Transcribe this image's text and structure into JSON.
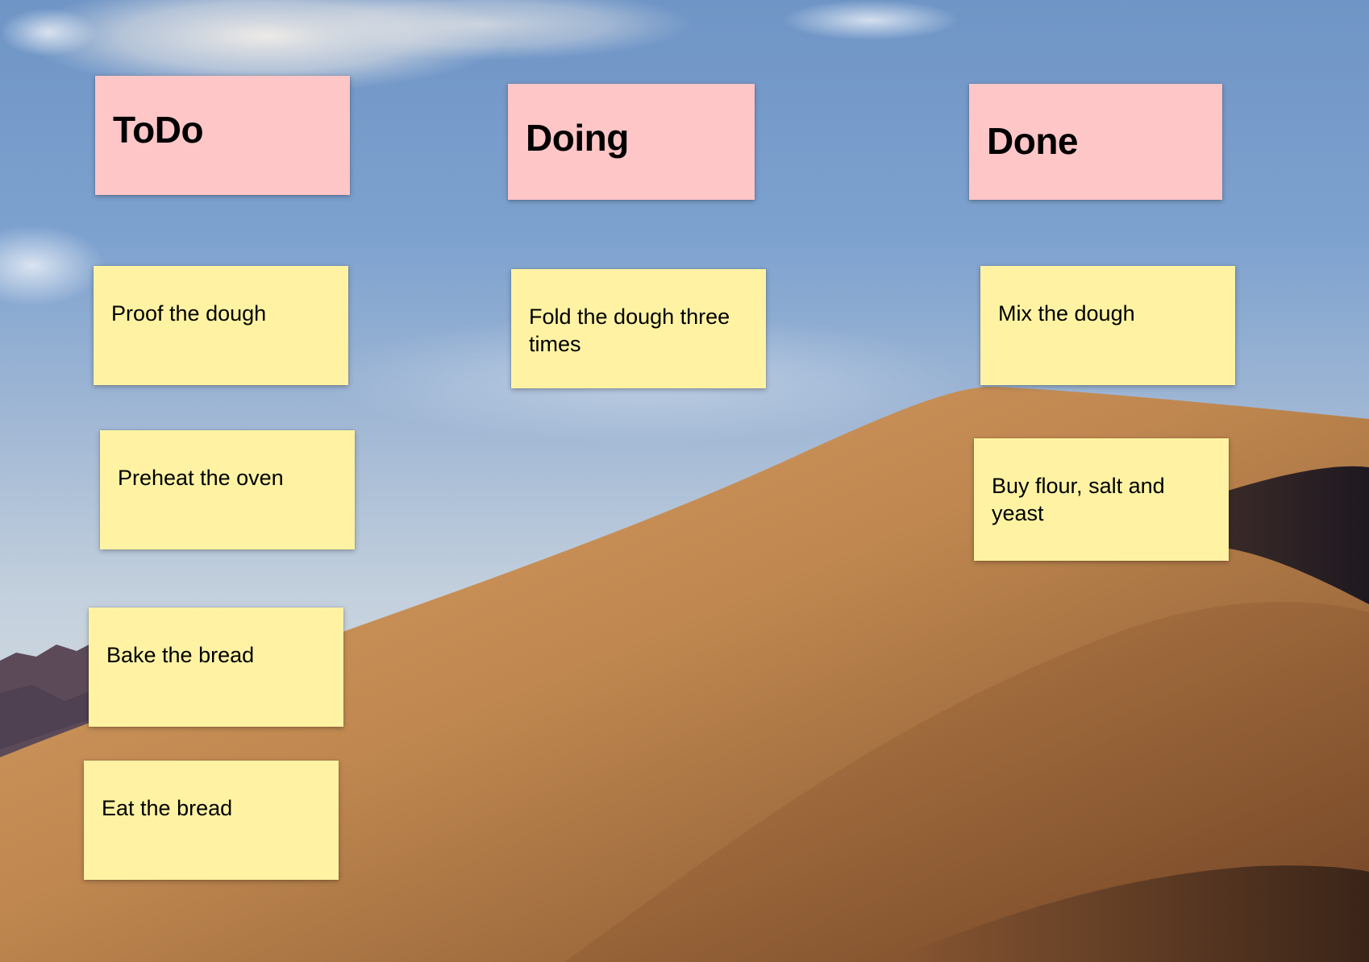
{
  "board": {
    "background": {
      "description": "macOS Mojave desert dune wallpaper",
      "sky_color": "#7ea2cf",
      "dune_color": "#c98f56"
    },
    "columns": [
      {
        "id": "todo",
        "title": "ToDo",
        "color": "#ffc6c7",
        "cards": [
          "Proof the dough",
          "Preheat the oven",
          "Bake the bread",
          "Eat the bread"
        ]
      },
      {
        "id": "doing",
        "title": "Doing",
        "color": "#ffc6c7",
        "cards": [
          "Fold the dough three times"
        ]
      },
      {
        "id": "done",
        "title": "Done",
        "color": "#ffc6c7",
        "cards": [
          "Mix the dough",
          "Buy flour, salt and yeast"
        ]
      }
    ],
    "card_color": "#fff3a3"
  }
}
